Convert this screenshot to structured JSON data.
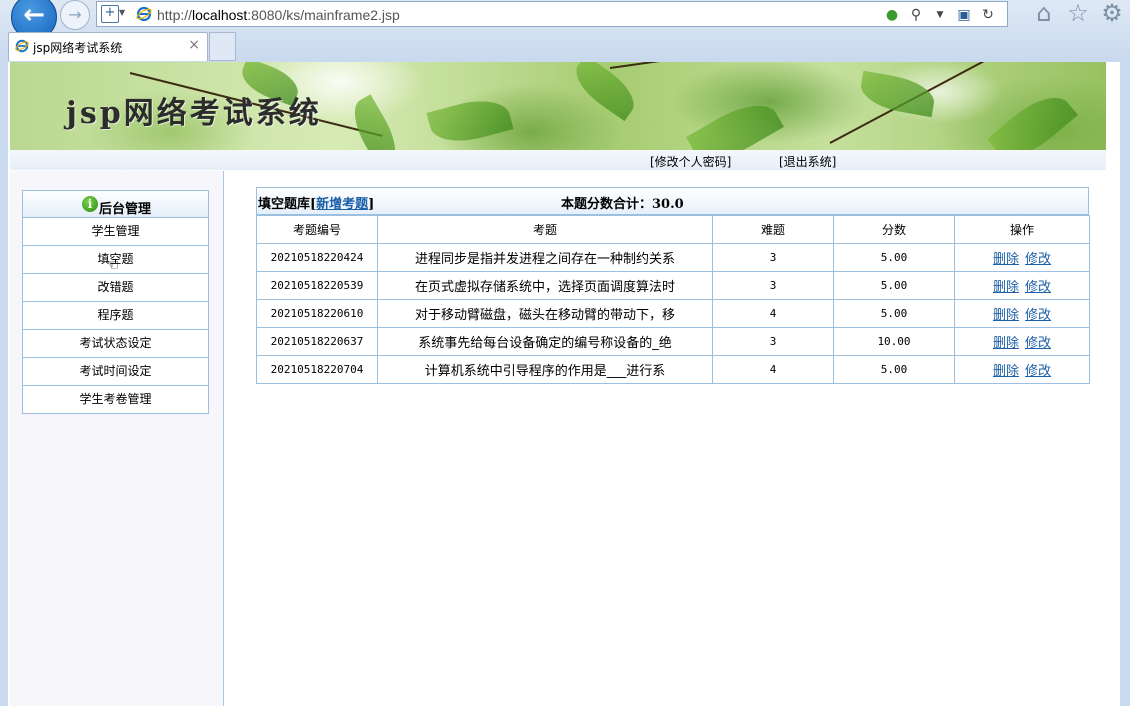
{
  "browser": {
    "url_prefix": "http://",
    "url_host": "localhost",
    "url_rest": ":8080/ks/mainframe2.jsp",
    "tab_title": "jsp网络考试系统",
    "tab_close": "×"
  },
  "header": {
    "system_title": "jsp网络考试系统",
    "links": [
      "[修改个人密码]",
      "[退出系统]"
    ]
  },
  "sidebar": {
    "heading": "后台管理",
    "items": [
      "学生管理",
      "填空题",
      "改错题",
      "程序题",
      "考试状态设定",
      "考试时间设定",
      "学生考卷管理"
    ]
  },
  "content": {
    "bank_label": "填空题库[",
    "add_link": "新增考题",
    "bank_close": "]",
    "total_label": "本题分数合计：30.0",
    "columns": [
      "考题编号",
      "考题",
      "难题",
      "分数",
      "操作"
    ],
    "rows": [
      {
        "id": "20210518220424",
        "topic": "进程同步是指并发进程之间存在一种制约关系",
        "difficulty": "3",
        "score": "5.00"
      },
      {
        "id": "20210518220539",
        "topic": "在页式虚拟存储系统中，选择页面调度算法时",
        "difficulty": "3",
        "score": "5.00"
      },
      {
        "id": "20210518220610",
        "topic": "对于移动臂磁盘，磁头在移动臂的带动下，移",
        "difficulty": "4",
        "score": "5.00"
      },
      {
        "id": "20210518220637",
        "topic": "系统事先给每台设备确定的编号称设备的_绝",
        "difficulty": "3",
        "score": "10.00"
      },
      {
        "id": "20210518220704",
        "topic": "计算机系统中引导程序的作用是___进行系",
        "difficulty": "4",
        "score": "5.00"
      }
    ],
    "delete_label": "删除",
    "edit_label": "修改"
  }
}
